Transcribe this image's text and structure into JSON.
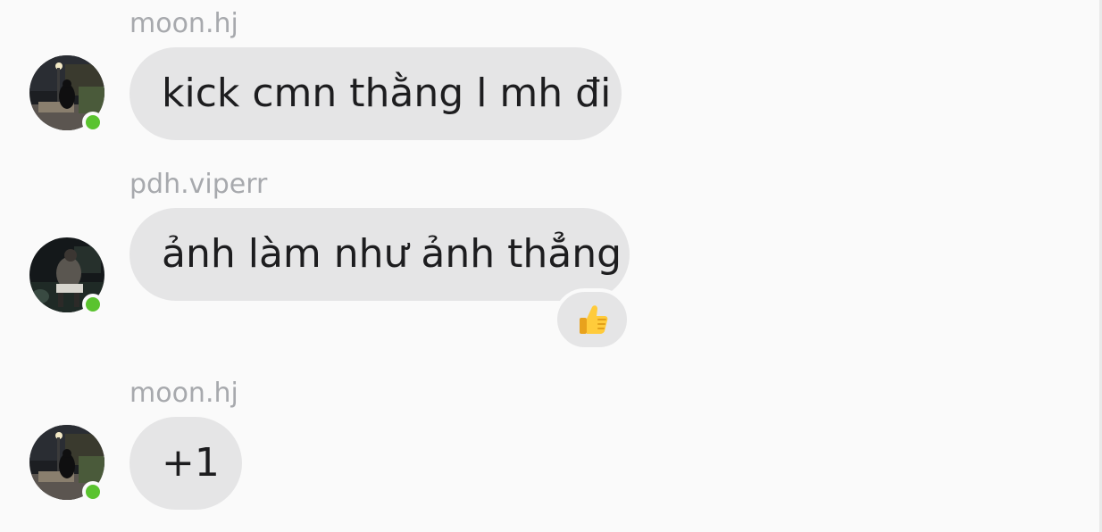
{
  "messages": [
    {
      "sender": "moon.hj",
      "text": "kick cmn thằng l mh đi",
      "avatar": "night-scene-avatar-icon",
      "online": true
    },
    {
      "sender": "pdh.viperr",
      "text": "ảnh làm như ảnh thẳng",
      "avatar": "person-dark-avatar-icon",
      "online": true,
      "reaction": "thumbs-up-icon"
    },
    {
      "sender": "moon.hj",
      "text": "+1",
      "avatar": "night-scene-avatar-icon",
      "online": true
    }
  ],
  "colors": {
    "background": "#fafafa",
    "bubble": "#e5e5e6",
    "sender_text": "#a7a9ad",
    "message_text": "#1d1d1f",
    "online": "#5ac32f"
  }
}
